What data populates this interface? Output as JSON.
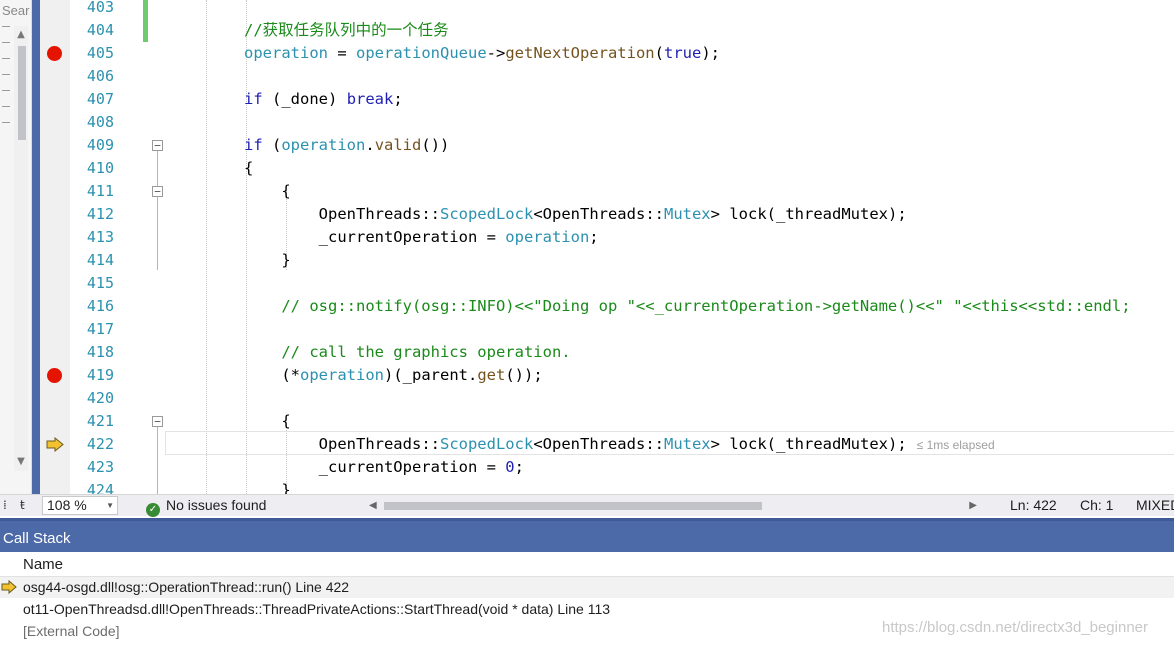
{
  "left_panel": {
    "search_placeholder": "Sear",
    "scroll_up": "▲",
    "scroll_down": "▼"
  },
  "editor": {
    "lines": [
      {
        "num": "403"
      },
      {
        "num": "404",
        "comment": "//获取任务队列中的一个任务"
      },
      {
        "num": "405",
        "breakpoint": true
      },
      {
        "num": "406"
      },
      {
        "num": "407"
      },
      {
        "num": "408"
      },
      {
        "num": "409",
        "fold": "−"
      },
      {
        "num": "410"
      },
      {
        "num": "411",
        "fold": "−"
      },
      {
        "num": "412"
      },
      {
        "num": "413"
      },
      {
        "num": "414"
      },
      {
        "num": "415"
      },
      {
        "num": "416",
        "comment": "// osg::notify(osg::INFO)<<\"Doing op \"<<_currentOperation->getName()<<\" \"<<this<<std::endl;"
      },
      {
        "num": "417"
      },
      {
        "num": "418",
        "comment": "// call the graphics operation."
      },
      {
        "num": "419",
        "breakpoint": true
      },
      {
        "num": "420"
      },
      {
        "num": "421",
        "fold": "−"
      },
      {
        "num": "422",
        "current": true,
        "elapsed": "≤ 1ms elapsed"
      },
      {
        "num": "423"
      },
      {
        "num": "424"
      }
    ]
  },
  "statusbar": {
    "zoom": "108 %",
    "issues": "No issues found",
    "ln": "Ln: 422",
    "ch": "Ch: 1",
    "mode": "MIXED"
  },
  "call_stack": {
    "title": "Call Stack",
    "column_name": "Name",
    "rows": [
      {
        "text": "osg44-osgd.dll!osg::OperationThread::run() Line 422",
        "current": true
      },
      {
        "text": "ot11-OpenThreadsd.dll!OpenThreads::ThreadPrivateActions::StartThread(void * data) Line 113"
      },
      {
        "text": "[External Code]"
      }
    ],
    "watermark": "https://blog.csdn.net/directx3d_beginner"
  },
  "colors": {
    "accent_blue": "#4d6aa8",
    "breakpoint": "#e51400",
    "line_number": "#2b91af",
    "comment": "#1a8a1a",
    "keyword": "#1f1fb4",
    "current_arrow": "#f2c230"
  }
}
